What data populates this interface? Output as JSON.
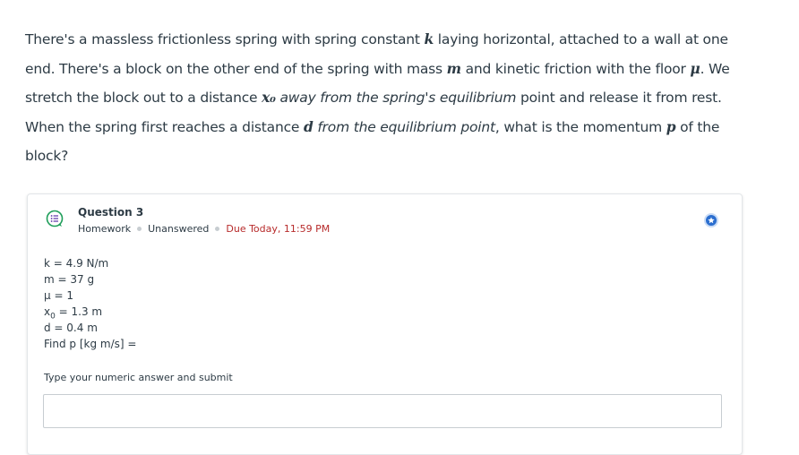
{
  "problem": {
    "p1": "There's a massless frictionless spring with spring constant ",
    "k": "k",
    "p2": " laying horizontal, attached to a wall at one end. There's a block on the other end of the spring with mass ",
    "m": "m",
    "p3": " and kinetic friction with the floor ",
    "mu": "μ",
    "p4": ". We stretch the block out to a distance ",
    "x0": "x₀",
    "p5": " away from the spring's equilibrium",
    "p6": " point and release it from rest. When the spring first reaches a distance ",
    "d": "d",
    "p7": " from the equilibrium point",
    "p8": ", what is the momentum ",
    "p": "p",
    "p9": " of the block?"
  },
  "question": {
    "title": "Question 3",
    "type": "Homework",
    "status": "Unanswered",
    "due": "Due Today, 11:59 PM"
  },
  "given": {
    "k": "k = 4.9 N/m",
    "m": "m = 37 g",
    "mu": "μ = 1",
    "x0_label": "x",
    "x0_sub": "0",
    "x0_value": " = 1.3 m",
    "d": "d = 0.4 m",
    "find": "Find p [kg m/s] ="
  },
  "answer": {
    "label": "Type your numeric answer and submit",
    "placeholder": "",
    "value": ""
  },
  "colors": {
    "text": "#2d3b45",
    "due": "#b72b2b",
    "accent": "#2b6ecf",
    "icon_green": "#1f9e5a"
  }
}
